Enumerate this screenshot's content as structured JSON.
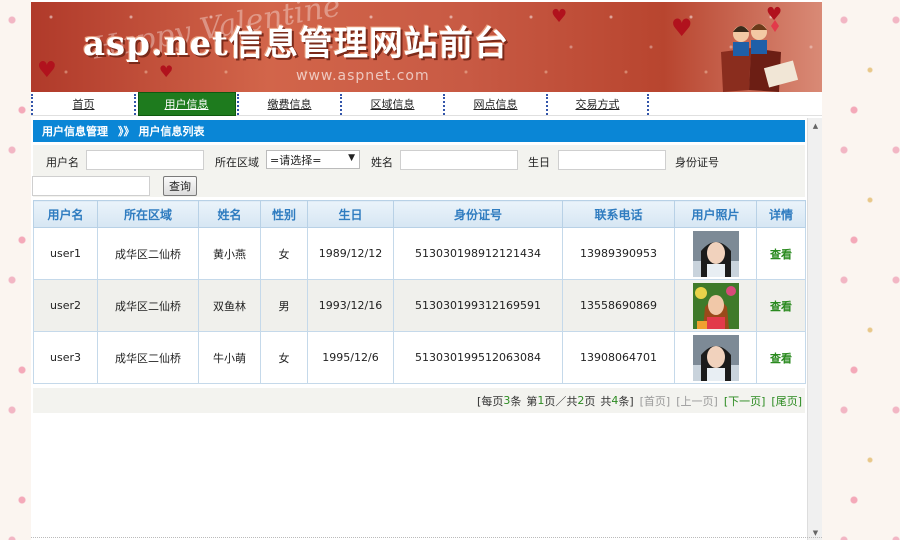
{
  "banner": {
    "title": "asp.net信息管理网站前台",
    "url": "www.aspnet.com"
  },
  "nav": {
    "items": [
      {
        "label": "首页",
        "active": false
      },
      {
        "label": "用户信息",
        "active": true
      },
      {
        "label": "缴费信息",
        "active": false
      },
      {
        "label": "区域信息",
        "active": false
      },
      {
        "label": "网点信息",
        "active": false
      },
      {
        "label": "交易方式",
        "active": false
      }
    ]
  },
  "titlebar": {
    "section": "用户信息管理",
    "separator": "》》",
    "page": "用户信息列表"
  },
  "search": {
    "username_label": "用户名",
    "username_value": "",
    "region_label": "所在区域",
    "region_selected": "=请选择=",
    "name_label": "姓名",
    "name_value": "",
    "birthday_label": "生日",
    "birthday_value": "",
    "idcard_label": "身份证号",
    "idcard_value": "",
    "query_button": "查询"
  },
  "table": {
    "headers": [
      "用户名",
      "所在区域",
      "姓名",
      "性别",
      "生日",
      "身份证号",
      "联系电话",
      "用户照片",
      "详情"
    ],
    "rows": [
      {
        "username": "user1",
        "region": "成华区二仙桥",
        "name": "黄小燕",
        "gender": "女",
        "birthday": "1989/12/12",
        "idcard": "513030198912121434",
        "phone": "13989390953",
        "photo": "photo-girl",
        "detail": "查看"
      },
      {
        "username": "user2",
        "region": "成华区二仙桥",
        "name": "双鱼林",
        "gender": "男",
        "birthday": "1993/12/16",
        "idcard": "513030199312169591",
        "phone": "13558690869",
        "photo": "photo-colorful",
        "detail": "查看"
      },
      {
        "username": "user3",
        "region": "成华区二仙桥",
        "name": "牛小萌",
        "gender": "女",
        "birthday": "1995/12/6",
        "idcard": "513030199512063084",
        "phone": "13908064701",
        "photo": "photo-girl",
        "detail": "查看"
      }
    ]
  },
  "pager": {
    "per_page_prefix": "[每页",
    "per_page": "3",
    "per_page_suffix": "条",
    "page_prefix": "第",
    "current_page": "1",
    "page_mid": "页／共",
    "total_pages": "2",
    "page_suffix": "页",
    "total_prefix": "共",
    "total_records": "4",
    "total_suffix": "条]",
    "first": "[首页]",
    "prev": "[上一页]",
    "next": "[下一页]",
    "last": "[尾页]"
  },
  "colors": {
    "titlebar": "#0a86d6",
    "nav_active": "#1e7b1e",
    "link": "#2a8a1f",
    "header_text": "#2f7cc0"
  }
}
